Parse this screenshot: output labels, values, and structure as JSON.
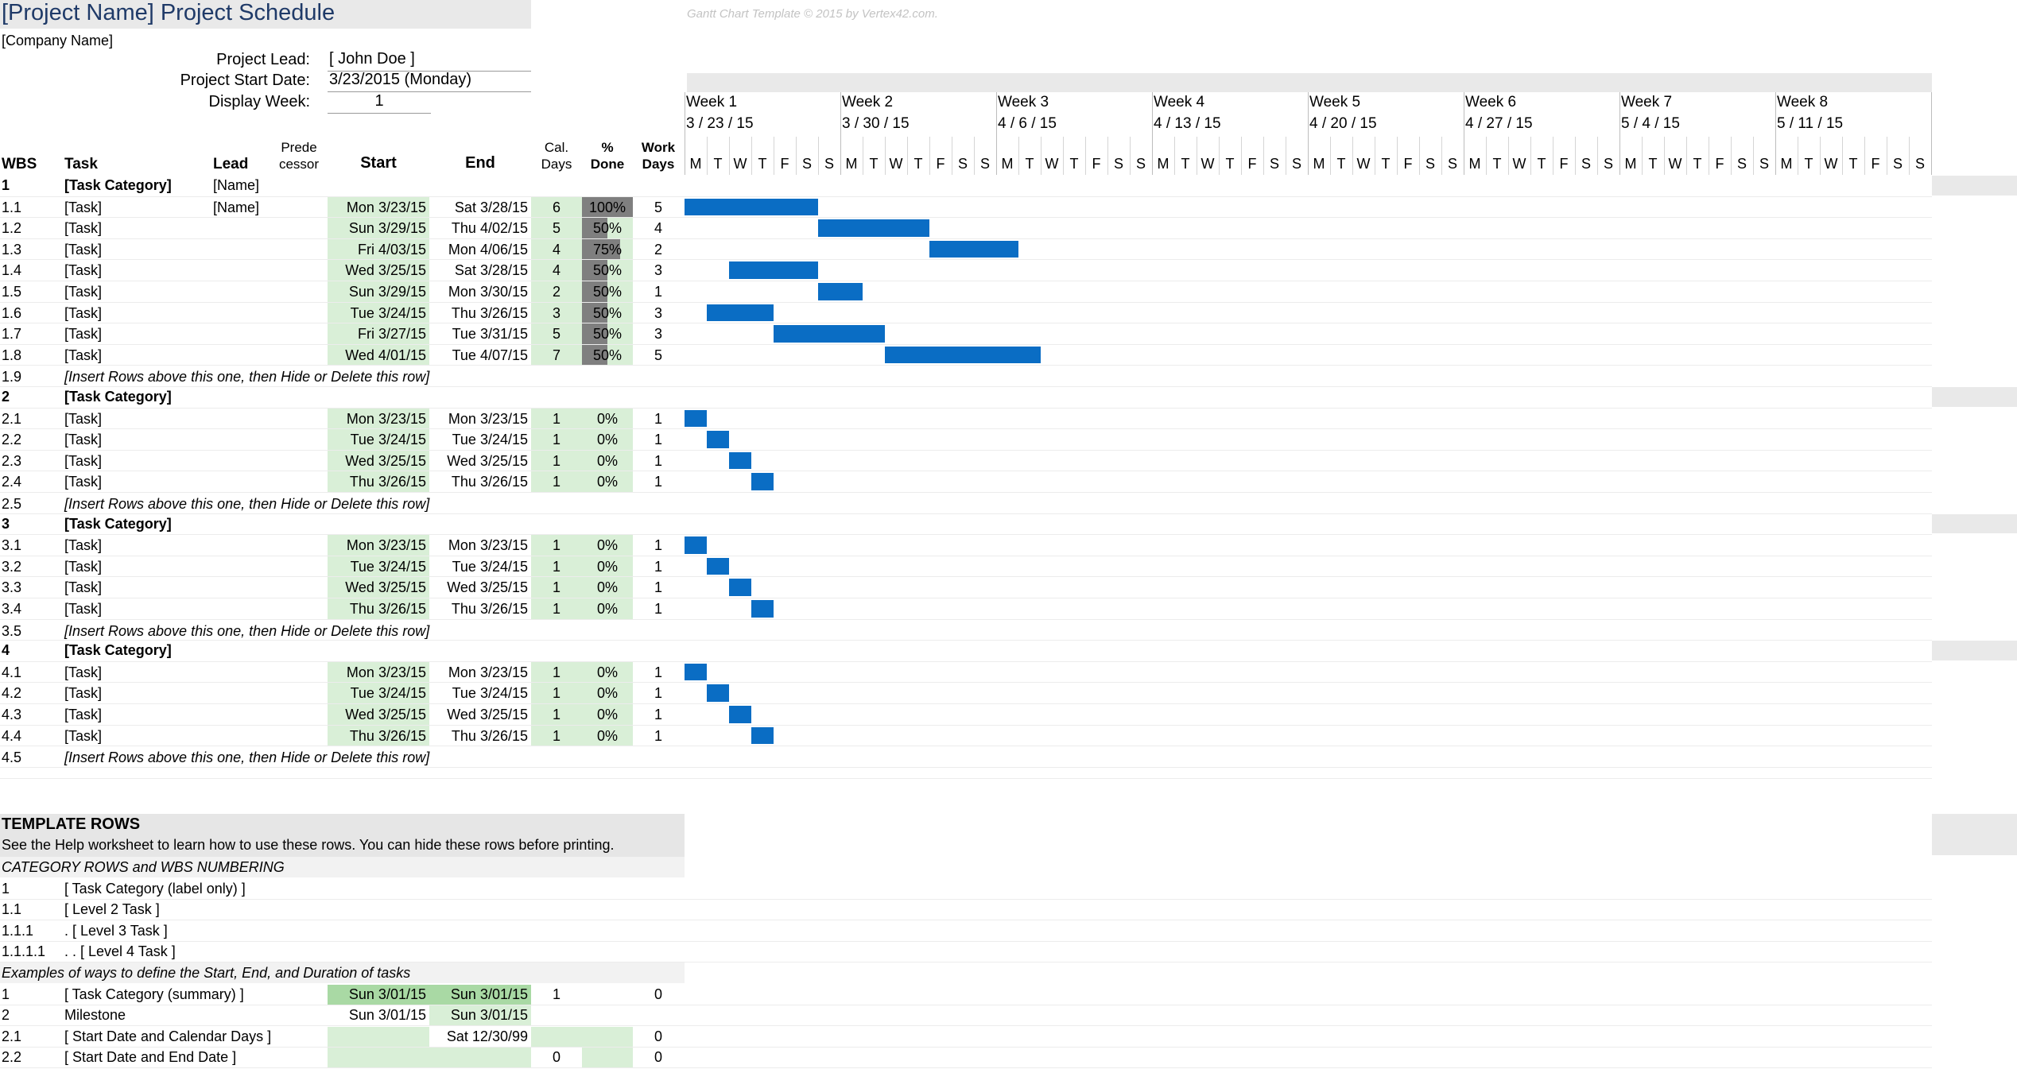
{
  "header": {
    "title": "[Project Name] Project Schedule",
    "credit": "Gantt Chart Template © 2015 by Vertex42.com.",
    "company": "[Company Name]",
    "lead_label": "Project Lead:",
    "lead_value": "[ John Doe ]",
    "start_label": "Project Start Date:",
    "start_value": "3/23/2015 (Monday)",
    "week_label": "Display Week:",
    "week_value": "1"
  },
  "columns": {
    "wbs": "WBS",
    "task": "Task",
    "lead": "Lead",
    "pred1": "Prede",
    "pred2": "cessor",
    "start": "Start",
    "end": "End",
    "cal1": "Cal.",
    "cal2": "Days",
    "pct1": "%",
    "pct2": "Done",
    "work1": "Work",
    "work2": "Days"
  },
  "weeks": [
    {
      "label": "Week 1",
      "date": "3 / 23 / 15"
    },
    {
      "label": "Week 2",
      "date": "3 / 30 / 15"
    },
    {
      "label": "Week 3",
      "date": "4 / 6 / 15"
    },
    {
      "label": "Week 4",
      "date": "4 / 13 / 15"
    },
    {
      "label": "Week 5",
      "date": "4 / 20 / 15"
    },
    {
      "label": "Week 6",
      "date": "4 / 27 / 15"
    },
    {
      "label": "Week 7",
      "date": "5 / 4 / 15"
    },
    {
      "label": "Week 8",
      "date": "5 / 11 / 15"
    }
  ],
  "day_letters": [
    "M",
    "T",
    "W",
    "T",
    "F",
    "S",
    "S"
  ],
  "rows": [
    {
      "type": "cat",
      "wbs": "1",
      "task": "[Task Category]",
      "lead": "[Name]"
    },
    {
      "type": "task",
      "wbs": "1.1",
      "task": "[Task]",
      "lead": "[Name]",
      "start": "Mon 3/23/15",
      "end": "Sat 3/28/15",
      "cal": "6",
      "pct": "100%",
      "pct_value": 1.0,
      "work": "5",
      "bar_start_day": 0,
      "bar_days": 6
    },
    {
      "type": "task",
      "wbs": "1.2",
      "task": "[Task]",
      "lead": "",
      "start": "Sun 3/29/15",
      "end": "Thu 4/02/15",
      "cal": "5",
      "pct": "50%",
      "pct_value": 0.5,
      "work": "4",
      "bar_start_day": 6,
      "bar_days": 5
    },
    {
      "type": "task",
      "wbs": "1.3",
      "task": "[Task]",
      "lead": "",
      "start": "Fri 4/03/15",
      "end": "Mon 4/06/15",
      "cal": "4",
      "pct": "75%",
      "pct_value": 0.75,
      "work": "2",
      "bar_start_day": 11,
      "bar_days": 4
    },
    {
      "type": "task",
      "wbs": "1.4",
      "task": "[Task]",
      "lead": "",
      "start": "Wed 3/25/15",
      "end": "Sat 3/28/15",
      "cal": "4",
      "pct": "50%",
      "pct_value": 0.5,
      "work": "3",
      "bar_start_day": 2,
      "bar_days": 4
    },
    {
      "type": "task",
      "wbs": "1.5",
      "task": "[Task]",
      "lead": "",
      "start": "Sun 3/29/15",
      "end": "Mon 3/30/15",
      "cal": "2",
      "pct": "50%",
      "pct_value": 0.5,
      "work": "1",
      "bar_start_day": 6,
      "bar_days": 2
    },
    {
      "type": "task",
      "wbs": "1.6",
      "task": "[Task]",
      "lead": "",
      "start": "Tue 3/24/15",
      "end": "Thu 3/26/15",
      "cal": "3",
      "pct": "50%",
      "pct_value": 0.5,
      "work": "3",
      "bar_start_day": 1,
      "bar_days": 3
    },
    {
      "type": "task",
      "wbs": "1.7",
      "task": "[Task]",
      "lead": "",
      "start": "Fri 3/27/15",
      "end": "Tue 3/31/15",
      "cal": "5",
      "pct": "50%",
      "pct_value": 0.5,
      "work": "3",
      "bar_start_day": 4,
      "bar_days": 5
    },
    {
      "type": "task",
      "wbs": "1.8",
      "task": "[Task]",
      "lead": "",
      "start": "Wed 4/01/15",
      "end": "Tue 4/07/15",
      "cal": "7",
      "pct": "50%",
      "pct_value": 0.5,
      "work": "5",
      "bar_start_day": 9,
      "bar_days": 7
    },
    {
      "type": "insert",
      "wbs": "1.9",
      "task": "[Insert Rows above this one, then Hide or Delete this row]"
    },
    {
      "type": "cat",
      "wbs": "2",
      "task": "[Task Category]",
      "lead": ""
    },
    {
      "type": "task",
      "wbs": "2.1",
      "task": "[Task]",
      "lead": "",
      "start": "Mon 3/23/15",
      "end": "Mon 3/23/15",
      "cal": "1",
      "pct": "0%",
      "pct_value": 0,
      "work": "1",
      "bar_start_day": 0,
      "bar_days": 1
    },
    {
      "type": "task",
      "wbs": "2.2",
      "task": "[Task]",
      "lead": "",
      "start": "Tue 3/24/15",
      "end": "Tue 3/24/15",
      "cal": "1",
      "pct": "0%",
      "pct_value": 0,
      "work": "1",
      "bar_start_day": 1,
      "bar_days": 1
    },
    {
      "type": "task",
      "wbs": "2.3",
      "task": "[Task]",
      "lead": "",
      "start": "Wed 3/25/15",
      "end": "Wed 3/25/15",
      "cal": "1",
      "pct": "0%",
      "pct_value": 0,
      "work": "1",
      "bar_start_day": 2,
      "bar_days": 1
    },
    {
      "type": "task",
      "wbs": "2.4",
      "task": "[Task]",
      "lead": "",
      "start": "Thu 3/26/15",
      "end": "Thu 3/26/15",
      "cal": "1",
      "pct": "0%",
      "pct_value": 0,
      "work": "1",
      "bar_start_day": 3,
      "bar_days": 1
    },
    {
      "type": "insert",
      "wbs": "2.5",
      "task": "[Insert Rows above this one, then Hide or Delete this row]"
    },
    {
      "type": "cat",
      "wbs": "3",
      "task": "[Task Category]",
      "lead": ""
    },
    {
      "type": "task",
      "wbs": "3.1",
      "task": "[Task]",
      "lead": "",
      "start": "Mon 3/23/15",
      "end": "Mon 3/23/15",
      "cal": "1",
      "pct": "0%",
      "pct_value": 0,
      "work": "1",
      "bar_start_day": 0,
      "bar_days": 1
    },
    {
      "type": "task",
      "wbs": "3.2",
      "task": "[Task]",
      "lead": "",
      "start": "Tue 3/24/15",
      "end": "Tue 3/24/15",
      "cal": "1",
      "pct": "0%",
      "pct_value": 0,
      "work": "1",
      "bar_start_day": 1,
      "bar_days": 1
    },
    {
      "type": "task",
      "wbs": "3.3",
      "task": "[Task]",
      "lead": "",
      "start": "Wed 3/25/15",
      "end": "Wed 3/25/15",
      "cal": "1",
      "pct": "0%",
      "pct_value": 0,
      "work": "1",
      "bar_start_day": 2,
      "bar_days": 1
    },
    {
      "type": "task",
      "wbs": "3.4",
      "task": "[Task]",
      "lead": "",
      "start": "Thu 3/26/15",
      "end": "Thu 3/26/15",
      "cal": "1",
      "pct": "0%",
      "pct_value": 0,
      "work": "1",
      "bar_start_day": 3,
      "bar_days": 1
    },
    {
      "type": "insert",
      "wbs": "3.5",
      "task": "[Insert Rows above this one, then Hide or Delete this row]"
    },
    {
      "type": "cat",
      "wbs": "4",
      "task": "[Task Category]",
      "lead": ""
    },
    {
      "type": "task",
      "wbs": "4.1",
      "task": "[Task]",
      "lead": "",
      "start": "Mon 3/23/15",
      "end": "Mon 3/23/15",
      "cal": "1",
      "pct": "0%",
      "pct_value": 0,
      "work": "1",
      "bar_start_day": 0,
      "bar_days": 1
    },
    {
      "type": "task",
      "wbs": "4.2",
      "task": "[Task]",
      "lead": "",
      "start": "Tue 3/24/15",
      "end": "Tue 3/24/15",
      "cal": "1",
      "pct": "0%",
      "pct_value": 0,
      "work": "1",
      "bar_start_day": 1,
      "bar_days": 1
    },
    {
      "type": "task",
      "wbs": "4.3",
      "task": "[Task]",
      "lead": "",
      "start": "Wed 3/25/15",
      "end": "Wed 3/25/15",
      "cal": "1",
      "pct": "0%",
      "pct_value": 0,
      "work": "1",
      "bar_start_day": 2,
      "bar_days": 1
    },
    {
      "type": "task",
      "wbs": "4.4",
      "task": "[Task]",
      "lead": "",
      "start": "Thu 3/26/15",
      "end": "Thu 3/26/15",
      "cal": "1",
      "pct": "0%",
      "pct_value": 0,
      "work": "1",
      "bar_start_day": 3,
      "bar_days": 1
    },
    {
      "type": "insert",
      "wbs": "4.5",
      "task": "[Insert Rows above this one, then Hide or Delete this row]"
    }
  ],
  "template": {
    "title": "TEMPLATE ROWS",
    "help": "See the Help worksheet to learn how to use these rows. You can hide these rows before printing.",
    "cat_heading": "CATEGORY ROWS and WBS NUMBERING",
    "levels": [
      {
        "wbs": "1",
        "task": "[ Task Category (label only) ]"
      },
      {
        "wbs": "1.1",
        "task": "[ Level 2 Task ]"
      },
      {
        "wbs": "1.1.1",
        "task": ". [ Level 3 Task ]"
      },
      {
        "wbs": "1.1.1.1",
        "task": ". . [ Level 4 Task ]"
      }
    ],
    "examples_heading": "Examples of ways to define the Start, End, and Duration of tasks",
    "examples": [
      {
        "wbs": "1",
        "task": "[ Task Category (summary) ]",
        "start": "Sun 3/01/15",
        "end": "Sun 3/01/15",
        "cal": "1",
        "work": "0"
      },
      {
        "wbs": "2",
        "task": "Milestone",
        "start": "Sun 3/01/15",
        "end": "Sun 3/01/15",
        "cal": "",
        "work": ""
      },
      {
        "wbs": "2.1",
        "task": "[ Start Date and Calendar Days ]",
        "start": "",
        "end": "Sat 12/30/99",
        "cal": "",
        "work": "0"
      },
      {
        "wbs": "2.2",
        "task": "[ Start Date and End Date ]",
        "start": "",
        "end": "",
        "cal": "0",
        "work": "0"
      }
    ]
  },
  "colors": {
    "bar": "#0a6dc4",
    "green_light": "#d9efd7",
    "green_mid": "#a9d9a4",
    "pct_fill": "#7f7f7f",
    "title": "#1f3a68"
  }
}
